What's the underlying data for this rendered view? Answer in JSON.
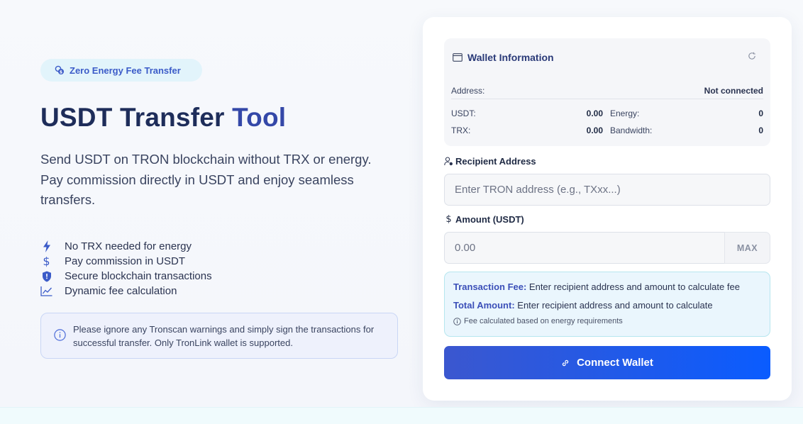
{
  "hero": {
    "badge_label": "Zero Energy Fee Transfer",
    "title_main": "USDT Transfer ",
    "title_accent": "Tool",
    "description": "Send USDT on TRON blockchain without TRX or energy. Pay commission directly in USDT and enjoy seamless transfers.",
    "features": [
      {
        "icon": "lightning-icon",
        "label": "No TRX needed for energy"
      },
      {
        "icon": "dollar-icon",
        "label": "Pay commission in USDT"
      },
      {
        "icon": "shield-icon",
        "label": "Secure blockchain transactions"
      },
      {
        "icon": "chart-line-icon",
        "label": "Dynamic fee calculation"
      }
    ],
    "notice": "Please ignore any Tronscan warnings and simply sign the transactions for successful transfer. Only TronLink wallet is supported."
  },
  "wallet": {
    "title": "Wallet Information",
    "address_label": "Address:",
    "address_value": "Not connected",
    "usdt_label": "USDT:",
    "usdt_value": "0.00",
    "energy_label": "Energy:",
    "energy_value": "0",
    "trx_label": "TRX:",
    "trx_value": "0.00",
    "bandwidth_label": "Bandwidth:",
    "bandwidth_value": "0"
  },
  "form": {
    "recipient_label": "Recipient Address",
    "recipient_placeholder": "Enter TRON address (e.g., TXxx...)",
    "amount_label": "Amount (USDT)",
    "amount_placeholder": "0.00",
    "amount_symbol": "$",
    "max_label": "MAX"
  },
  "fee": {
    "transaction_fee_key": "Transaction Fee:",
    "transaction_fee_value": " Enter recipient address and amount to calculate fee",
    "total_amount_key": "Total Amount:",
    "total_amount_value": " Enter recipient address and amount to calculate",
    "note": "Fee calculated based on energy requirements"
  },
  "connect_label": "Connect Wallet",
  "colors": {
    "accent": "#3b57cf",
    "title_dark": "#1e2d5a",
    "badge_bg": "#e2f4fb"
  }
}
